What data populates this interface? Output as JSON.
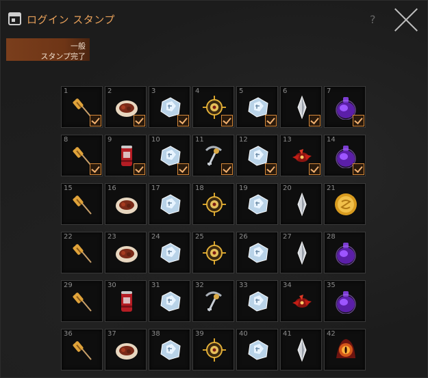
{
  "window": {
    "title": "ログイン スタンプ",
    "help_label": "?"
  },
  "tab": {
    "line1": "一般",
    "line2": "スタンプ完了"
  },
  "slots": [
    {
      "num": "1",
      "item": "skewer-icon",
      "claimed": true
    },
    {
      "num": "2",
      "item": "meat-plate-icon",
      "claimed": true
    },
    {
      "num": "3",
      "item": "crystal-icon",
      "claimed": true
    },
    {
      "num": "4",
      "item": "compass-icon",
      "claimed": true
    },
    {
      "num": "5",
      "item": "crystal-icon",
      "claimed": true
    },
    {
      "num": "6",
      "item": "shard-icon",
      "claimed": true
    },
    {
      "num": "7",
      "item": "purple-potion-icon",
      "claimed": true
    },
    {
      "num": "8",
      "item": "skewer-icon",
      "claimed": true
    },
    {
      "num": "9",
      "item": "soda-can-icon",
      "claimed": true
    },
    {
      "num": "10",
      "item": "crystal-icon",
      "claimed": true
    },
    {
      "num": "11",
      "item": "key-icon",
      "claimed": true
    },
    {
      "num": "12",
      "item": "crystal-icon",
      "claimed": true
    },
    {
      "num": "13",
      "item": "red-creature-icon",
      "claimed": true
    },
    {
      "num": "14",
      "item": "purple-potion-icon",
      "claimed": true
    },
    {
      "num": "15",
      "item": "skewer-icon",
      "claimed": false
    },
    {
      "num": "16",
      "item": "meat-plate-icon",
      "claimed": false
    },
    {
      "num": "17",
      "item": "crystal-icon",
      "claimed": false
    },
    {
      "num": "18",
      "item": "compass-icon",
      "claimed": false
    },
    {
      "num": "19",
      "item": "crystal-icon",
      "claimed": false
    },
    {
      "num": "20",
      "item": "shard-icon",
      "claimed": false
    },
    {
      "num": "21",
      "item": "gold-coin-icon",
      "claimed": false
    },
    {
      "num": "22",
      "item": "skewer-icon",
      "claimed": false
    },
    {
      "num": "23",
      "item": "meat-plate-icon",
      "claimed": false
    },
    {
      "num": "24",
      "item": "crystal-icon",
      "claimed": false
    },
    {
      "num": "25",
      "item": "compass-icon",
      "claimed": false
    },
    {
      "num": "26",
      "item": "crystal-icon",
      "claimed": false
    },
    {
      "num": "27",
      "item": "shard-icon",
      "claimed": false
    },
    {
      "num": "28",
      "item": "purple-potion-icon",
      "claimed": false
    },
    {
      "num": "29",
      "item": "skewer-icon",
      "claimed": false
    },
    {
      "num": "30",
      "item": "soda-can-icon",
      "claimed": false
    },
    {
      "num": "31",
      "item": "crystal-icon",
      "claimed": false
    },
    {
      "num": "32",
      "item": "key-icon",
      "claimed": false
    },
    {
      "num": "33",
      "item": "crystal-icon",
      "claimed": false
    },
    {
      "num": "34",
      "item": "red-creature-icon",
      "claimed": false
    },
    {
      "num": "35",
      "item": "purple-potion-icon",
      "claimed": false
    },
    {
      "num": "36",
      "item": "skewer-icon",
      "claimed": false
    },
    {
      "num": "37",
      "item": "meat-plate-icon",
      "claimed": false
    },
    {
      "num": "38",
      "item": "crystal-icon",
      "claimed": false
    },
    {
      "num": "39",
      "item": "compass-icon",
      "claimed": false
    },
    {
      "num": "40",
      "item": "crystal-icon",
      "claimed": false
    },
    {
      "num": "41",
      "item": "shard-icon",
      "claimed": false
    },
    {
      "num": "42",
      "item": "fire-eye-icon",
      "claimed": false
    }
  ]
}
